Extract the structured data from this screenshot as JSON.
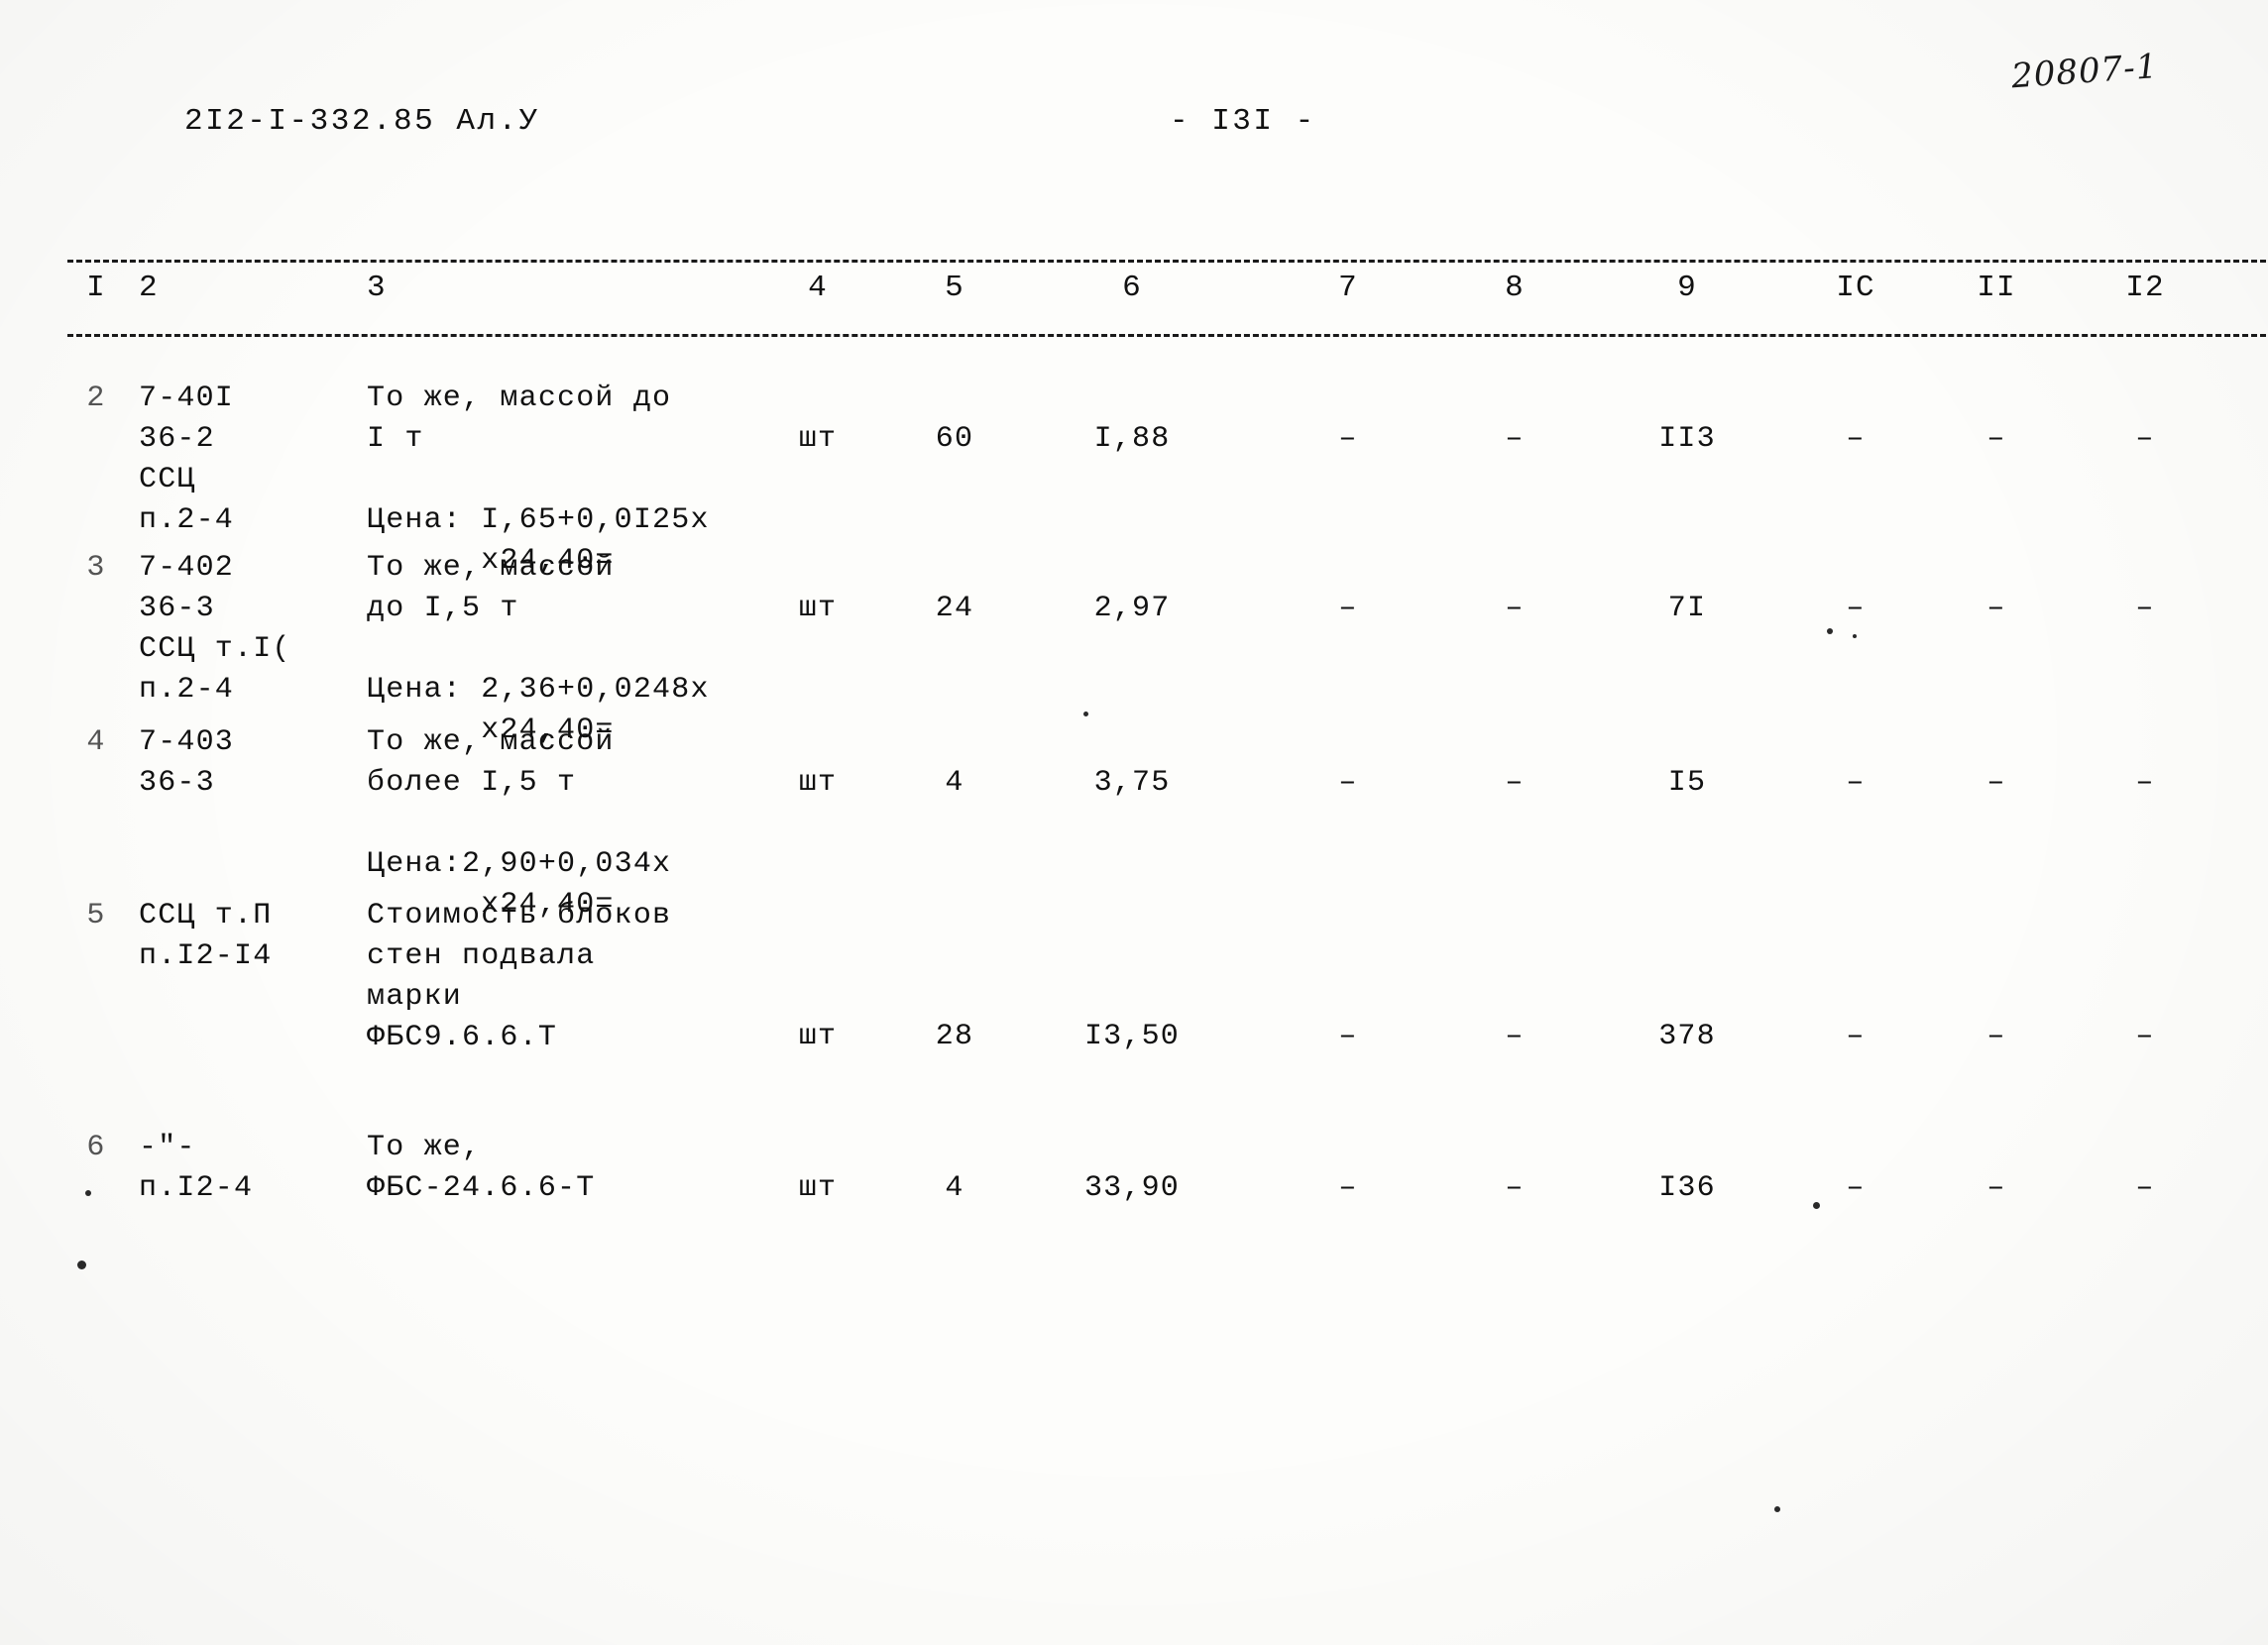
{
  "page": {
    "handwritten_note": "20807-1",
    "document_code": "2I2-I-332.85 Ал.У",
    "page_label": "- I3I -"
  },
  "table": {
    "column_headers": [
      "I",
      "2",
      "3",
      "4",
      "5",
      "6",
      "7",
      "8",
      "9",
      "IC",
      "II",
      "I2"
    ],
    "rows": [
      {
        "num": "2",
        "code_lines": [
          "7-40I",
          "36-2",
          "ССЦ",
          "п.2-4"
        ],
        "desc_lines": [
          "То же, массой до",
          "I т",
          "",
          "Цена: I,65+0,0I25х",
          "      х24,40="
        ],
        "unit": "шт",
        "qty": "60",
        "price": "I,88",
        "col7": "–",
        "col8": "–",
        "total": "II3",
        "col10": "–",
        "col11": "–",
        "col12": "–"
      },
      {
        "num": "3",
        "code_lines": [
          "7-402",
          "36-3",
          "ССЦ т.I(",
          "п.2-4"
        ],
        "desc_lines": [
          "То же, массой",
          "до I,5 т",
          "",
          "Цена: 2,36+0,0248х",
          "      х24,40="
        ],
        "unit": "шт",
        "qty": "24",
        "price": "2,97",
        "col7": "–",
        "col8": "–",
        "total": "7I",
        "col10": "–",
        "col11": "–",
        "col12": "–"
      },
      {
        "num": "4",
        "code_lines": [
          "7-403",
          "36-3"
        ],
        "desc_lines": [
          "То же, массой",
          "более I,5 т",
          "",
          "Цена:2,90+0,034х",
          "      х24,40="
        ],
        "unit": "шт",
        "qty": "4",
        "price": "3,75",
        "col7": "–",
        "col8": "–",
        "total": "I5",
        "col10": "–",
        "col11": "–",
        "col12": "–"
      },
      {
        "num": "5",
        "code_lines": [
          "ССЦ т.П",
          "п.I2-I4"
        ],
        "desc_lines": [
          "Стоимость блоков",
          "стен подвала",
          "марки",
          "ФБС9.6.6.Т"
        ],
        "unit": "шт",
        "qty": "28",
        "price": "I3,50",
        "col7": "–",
        "col8": "–",
        "total": "378",
        "col10": "–",
        "col11": "–",
        "col12": "–"
      },
      {
        "num": "6",
        "code_lines": [
          "-\"-",
          "п.I2-4"
        ],
        "desc_lines": [
          "То же,",
          "ФБС-24.6.6-Т"
        ],
        "unit": "шт",
        "qty": "4",
        "price": "33,90",
        "col7": "–",
        "col8": "–",
        "total": "I36",
        "col10": "–",
        "col11": "–",
        "col12": "–"
      }
    ]
  }
}
